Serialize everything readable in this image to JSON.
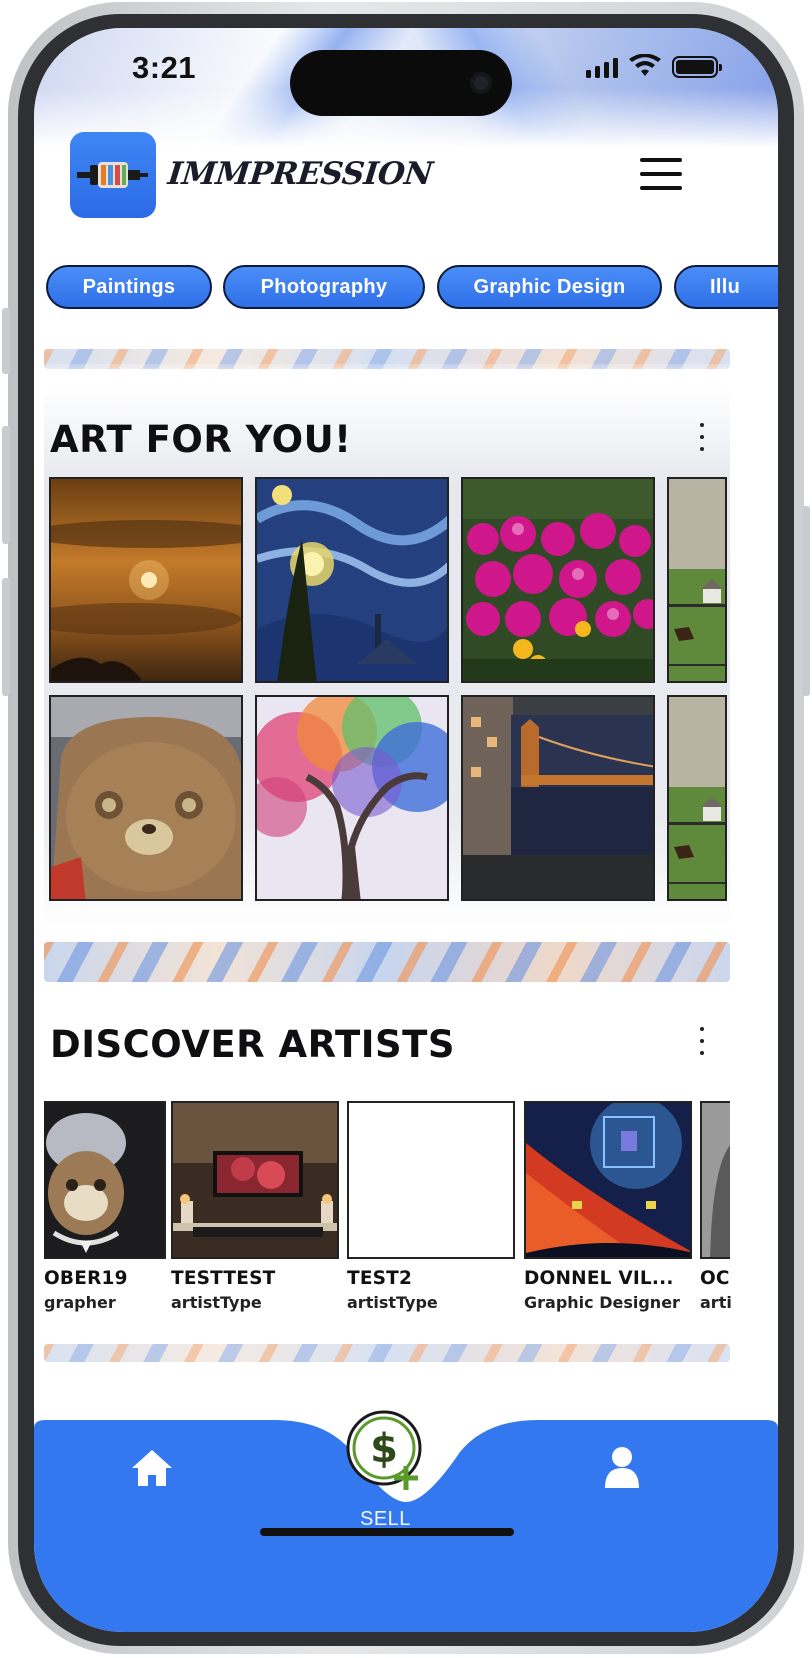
{
  "status_bar": {
    "time": "3:21"
  },
  "header": {
    "brand_name": "IMMPRESSION"
  },
  "categories": [
    "Paintings",
    "Photography",
    "Graphic Design",
    "Illu"
  ],
  "art_section": {
    "title": "ART FOR YOU!"
  },
  "artists_section": {
    "title": "DISCOVER ARTISTS",
    "artists": [
      {
        "name": "OBER19",
        "type": "grapher"
      },
      {
        "name": "TESTTEST",
        "type": "artistType"
      },
      {
        "name": "TEST2",
        "type": "artistType"
      },
      {
        "name": "DONNEL VIL...",
        "type": "Graphic Designer"
      },
      {
        "name": "OC",
        "type": "arti"
      }
    ]
  },
  "bottom_nav": {
    "sell_label": "SELL"
  },
  "colors": {
    "accent": "#3478f0",
    "sell_green": "#5a9a2a",
    "text": "#111111"
  }
}
